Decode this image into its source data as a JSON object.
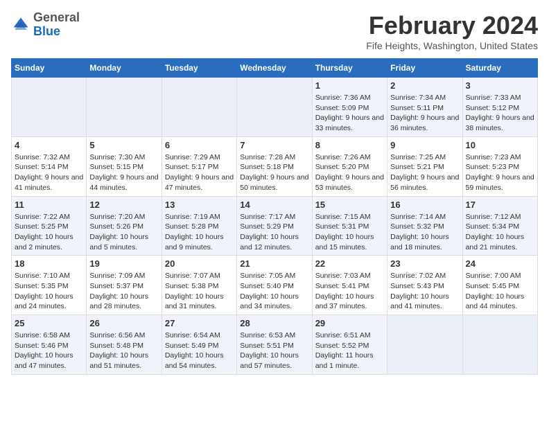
{
  "header": {
    "logo_general": "General",
    "logo_blue": "Blue",
    "month_title": "February 2024",
    "location": "Fife Heights, Washington, United States"
  },
  "weekdays": [
    "Sunday",
    "Monday",
    "Tuesday",
    "Wednesday",
    "Thursday",
    "Friday",
    "Saturday"
  ],
  "weeks": [
    [
      {
        "empty": true
      },
      {
        "empty": true
      },
      {
        "empty": true
      },
      {
        "empty": true
      },
      {
        "day": 1,
        "sunrise": "7:36 AM",
        "sunset": "5:09 PM",
        "daylight": "9 hours and 33 minutes."
      },
      {
        "day": 2,
        "sunrise": "7:34 AM",
        "sunset": "5:11 PM",
        "daylight": "9 hours and 36 minutes."
      },
      {
        "day": 3,
        "sunrise": "7:33 AM",
        "sunset": "5:12 PM",
        "daylight": "9 hours and 38 minutes."
      }
    ],
    [
      {
        "day": 4,
        "sunrise": "7:32 AM",
        "sunset": "5:14 PM",
        "daylight": "9 hours and 41 minutes."
      },
      {
        "day": 5,
        "sunrise": "7:30 AM",
        "sunset": "5:15 PM",
        "daylight": "9 hours and 44 minutes."
      },
      {
        "day": 6,
        "sunrise": "7:29 AM",
        "sunset": "5:17 PM",
        "daylight": "9 hours and 47 minutes."
      },
      {
        "day": 7,
        "sunrise": "7:28 AM",
        "sunset": "5:18 PM",
        "daylight": "9 hours and 50 minutes."
      },
      {
        "day": 8,
        "sunrise": "7:26 AM",
        "sunset": "5:20 PM",
        "daylight": "9 hours and 53 minutes."
      },
      {
        "day": 9,
        "sunrise": "7:25 AM",
        "sunset": "5:21 PM",
        "daylight": "9 hours and 56 minutes."
      },
      {
        "day": 10,
        "sunrise": "7:23 AM",
        "sunset": "5:23 PM",
        "daylight": "9 hours and 59 minutes."
      }
    ],
    [
      {
        "day": 11,
        "sunrise": "7:22 AM",
        "sunset": "5:25 PM",
        "daylight": "10 hours and 2 minutes."
      },
      {
        "day": 12,
        "sunrise": "7:20 AM",
        "sunset": "5:26 PM",
        "daylight": "10 hours and 5 minutes."
      },
      {
        "day": 13,
        "sunrise": "7:19 AM",
        "sunset": "5:28 PM",
        "daylight": "10 hours and 9 minutes."
      },
      {
        "day": 14,
        "sunrise": "7:17 AM",
        "sunset": "5:29 PM",
        "daylight": "10 hours and 12 minutes."
      },
      {
        "day": 15,
        "sunrise": "7:15 AM",
        "sunset": "5:31 PM",
        "daylight": "10 hours and 15 minutes."
      },
      {
        "day": 16,
        "sunrise": "7:14 AM",
        "sunset": "5:32 PM",
        "daylight": "10 hours and 18 minutes."
      },
      {
        "day": 17,
        "sunrise": "7:12 AM",
        "sunset": "5:34 PM",
        "daylight": "10 hours and 21 minutes."
      }
    ],
    [
      {
        "day": 18,
        "sunrise": "7:10 AM",
        "sunset": "5:35 PM",
        "daylight": "10 hours and 24 minutes."
      },
      {
        "day": 19,
        "sunrise": "7:09 AM",
        "sunset": "5:37 PM",
        "daylight": "10 hours and 28 minutes."
      },
      {
        "day": 20,
        "sunrise": "7:07 AM",
        "sunset": "5:38 PM",
        "daylight": "10 hours and 31 minutes."
      },
      {
        "day": 21,
        "sunrise": "7:05 AM",
        "sunset": "5:40 PM",
        "daylight": "10 hours and 34 minutes."
      },
      {
        "day": 22,
        "sunrise": "7:03 AM",
        "sunset": "5:41 PM",
        "daylight": "10 hours and 37 minutes."
      },
      {
        "day": 23,
        "sunrise": "7:02 AM",
        "sunset": "5:43 PM",
        "daylight": "10 hours and 41 minutes."
      },
      {
        "day": 24,
        "sunrise": "7:00 AM",
        "sunset": "5:45 PM",
        "daylight": "10 hours and 44 minutes."
      }
    ],
    [
      {
        "day": 25,
        "sunrise": "6:58 AM",
        "sunset": "5:46 PM",
        "daylight": "10 hours and 47 minutes."
      },
      {
        "day": 26,
        "sunrise": "6:56 AM",
        "sunset": "5:48 PM",
        "daylight": "10 hours and 51 minutes."
      },
      {
        "day": 27,
        "sunrise": "6:54 AM",
        "sunset": "5:49 PM",
        "daylight": "10 hours and 54 minutes."
      },
      {
        "day": 28,
        "sunrise": "6:53 AM",
        "sunset": "5:51 PM",
        "daylight": "10 hours and 57 minutes."
      },
      {
        "day": 29,
        "sunrise": "6:51 AM",
        "sunset": "5:52 PM",
        "daylight": "11 hours and 1 minute."
      },
      {
        "empty": true
      },
      {
        "empty": true
      }
    ]
  ]
}
